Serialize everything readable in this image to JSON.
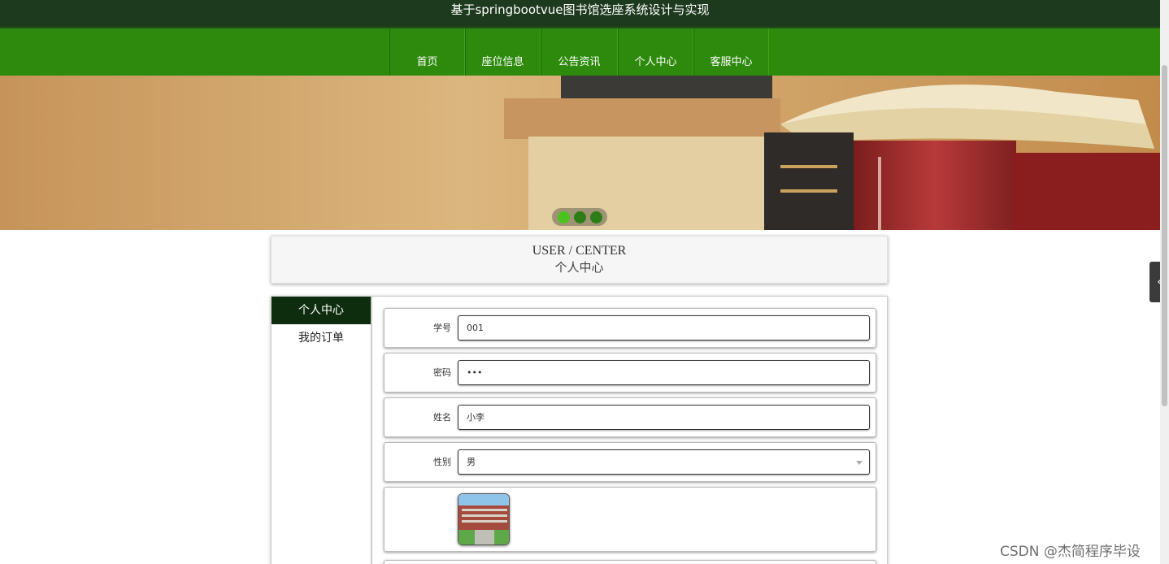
{
  "header": {
    "title": "基于springbootvue图书馆选座系统设计与实现"
  },
  "nav": [
    {
      "label": "首页"
    },
    {
      "label": "座位信息"
    },
    {
      "label": "公告资讯"
    },
    {
      "label": "个人中心"
    },
    {
      "label": "客服中心"
    }
  ],
  "banner": {
    "slides_count": 3,
    "active_slide": 1
  },
  "section": {
    "title_en": "USER / CENTER",
    "title_cn": "个人中心"
  },
  "sidemenu": [
    {
      "label": "个人中心",
      "active": true
    },
    {
      "label": "我的订单",
      "active": false
    }
  ],
  "form": {
    "student_id": {
      "label": "学号",
      "value": "001"
    },
    "password": {
      "label": "密码",
      "value": "•••"
    },
    "name": {
      "label": "姓名",
      "value": "小李"
    },
    "gender": {
      "label": "性别",
      "value": "男"
    },
    "photo": {
      "label": ""
    }
  },
  "watermark": "CSDN @杰简程序毕设",
  "colors": {
    "titlebar": "#1e3a1e",
    "nav": "#2d8a0d",
    "sidemenu_active": "#0e2d0e",
    "dot_active": "#4cc21e"
  }
}
